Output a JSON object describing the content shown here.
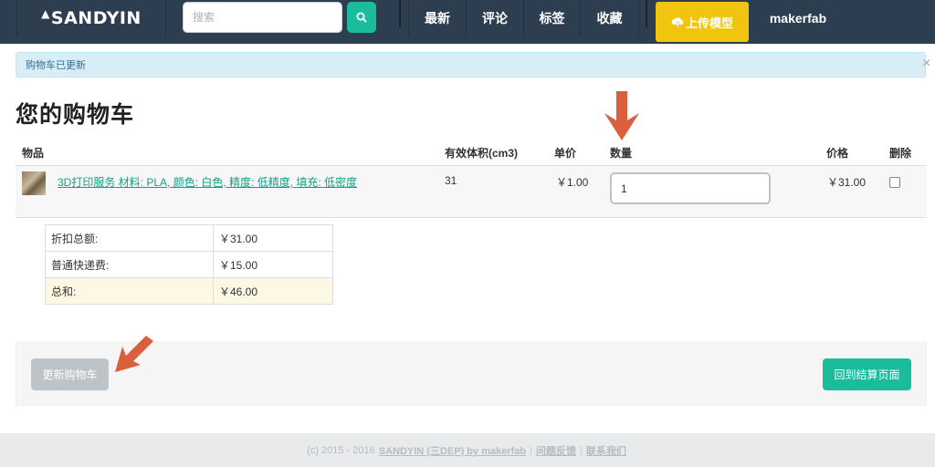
{
  "nav": {
    "logo": "SANDYIN",
    "search_placeholder": "搜索",
    "items": [
      "最新",
      "评论",
      "标签",
      "收藏"
    ],
    "upload_label": "上传模型",
    "user": "makerfab"
  },
  "alert": {
    "text": "购物车已更新",
    "close": "×"
  },
  "page": {
    "title": "您的购物车"
  },
  "table": {
    "headers": {
      "item": "物品",
      "volume": "有效体积(cm3)",
      "unit_price": "单价",
      "quantity": "数量",
      "price": "价格",
      "delete": "删除"
    },
    "row": {
      "name": "3D打印服务 材料: PLA, 颜色: 白色, 精度: 低精度, 填充: 低密度",
      "volume": "31",
      "unit_price": "￥1.00",
      "quantity": "1",
      "price": "￥31.00"
    }
  },
  "summary": {
    "discount_label": "折扣总额:",
    "discount_value": "￥31.00",
    "shipping_label": "普通快递费:",
    "shipping_value": "￥15.00",
    "total_label": "总和:",
    "total_value": "￥46.00"
  },
  "actions": {
    "update": "更新购物车",
    "checkout": "回到结算页面"
  },
  "footer": {
    "copyright": "(c) 2015 - 2016",
    "brand": "SANDYIN (三DEP) by makerfab",
    "sep1": "|",
    "feedback": "问题反馈",
    "sep2": "|",
    "contact": "联系我们"
  },
  "colors": {
    "nav_bg": "#2c3e50",
    "accent": "#1abc9c",
    "upload": "#f1c40f",
    "arrow": "#d9603b"
  }
}
